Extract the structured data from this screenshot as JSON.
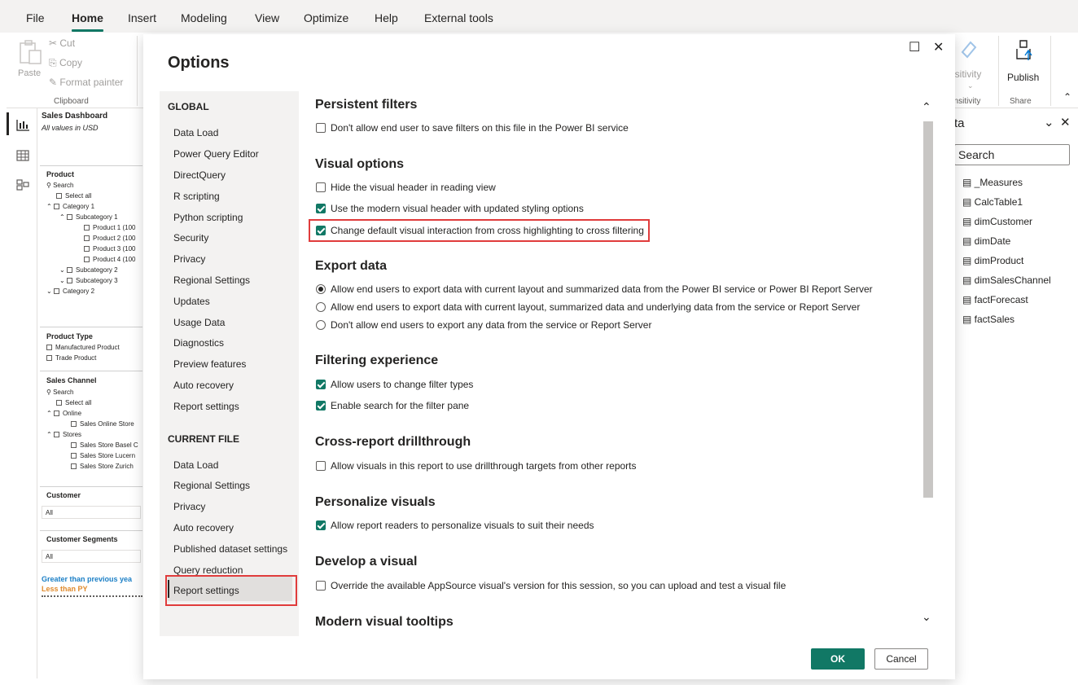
{
  "menu": {
    "tabs": [
      "File",
      "Home",
      "Insert",
      "Modeling",
      "View",
      "Optimize",
      "Help",
      "External tools"
    ]
  },
  "ribbon": {
    "paste": "Paste",
    "cut": "Cut",
    "copy": "Copy",
    "format_painter": "Format painter",
    "clipboard_group": "Clipboard",
    "sensitivity": "nsitivity",
    "sensitivity_group": "ensitivity",
    "publish": "Publish",
    "share_group": "Share"
  },
  "canvas": {
    "title": "Sales Dashboard",
    "subtitle": "All values in USD",
    "product_label": "Product",
    "search": "Search",
    "select_all": "Select all",
    "category1": "Category 1",
    "subcategory1": "Subcategory 1",
    "product1": "Product 1 (100",
    "product2": "Product 2 (100",
    "product3": "Product 3 (100",
    "product4": "Product 4 (100",
    "subcategory2": "Subcategory 2",
    "subcategory3": "Subcategory 3",
    "category2": "Category 2",
    "product_type": "Product Type",
    "manufactured": "Manufactured Product",
    "trade": "Trade Product",
    "sales_channel": "Sales Channel",
    "online": "Online",
    "online_store": "Sales Online Store",
    "stores": "Stores",
    "basel": "Sales Store Basel C",
    "lucern": "Sales Store Lucern",
    "zurich": "Sales Store Zurich",
    "customer": "Customer",
    "all": "All",
    "customer_segments": "Customer Segments",
    "greater": "Greater than previous yea",
    "less": "Less than PY"
  },
  "datapane": {
    "title": "ta",
    "search": "Search",
    "items": [
      "_Measures",
      "CalcTable1",
      "dimCustomer",
      "dimDate",
      "dimProduct",
      "dimSalesChannel",
      "factForecast",
      "factSales"
    ]
  },
  "dialog": {
    "title": "Options",
    "global_head": "GLOBAL",
    "global_items": [
      "Data Load",
      "Power Query Editor",
      "DirectQuery",
      "R scripting",
      "Python scripting",
      "Security",
      "Privacy",
      "Regional Settings",
      "Updates",
      "Usage Data",
      "Diagnostics",
      "Preview features",
      "Auto recovery",
      "Report settings"
    ],
    "current_head": "CURRENT FILE",
    "current_items": [
      "Data Load",
      "Regional Settings",
      "Privacy",
      "Auto recovery",
      "Published dataset settings",
      "Query reduction",
      "Report settings"
    ],
    "ok": "OK",
    "cancel": "Cancel",
    "sections": {
      "persistent": {
        "title": "Persistent filters",
        "opt1": "Don't allow end user to save filters on this file in the Power BI service"
      },
      "visual": {
        "title": "Visual options",
        "opt1": "Hide the visual header in reading view",
        "opt2": "Use the modern visual header with updated styling options",
        "opt3": "Change default visual interaction from cross highlighting to cross filtering"
      },
      "export": {
        "title": "Export data",
        "opt1": "Allow end users to export data with current layout and summarized data from the Power BI service or Power BI Report Server",
        "opt2": "Allow end users to export data with current layout, summarized data and underlying data from the service or Report Server",
        "opt3": "Don't allow end users to export any data from the service or Report Server"
      },
      "filtering": {
        "title": "Filtering experience",
        "opt1": "Allow users to change filter types",
        "opt2": "Enable search for the filter pane"
      },
      "drill": {
        "title": "Cross-report drillthrough",
        "opt1": "Allow visuals in this report to use drillthrough targets from other reports"
      },
      "personalize": {
        "title": "Personalize visuals",
        "opt1": "Allow report readers to personalize visuals to suit their needs"
      },
      "develop": {
        "title": "Develop a visual",
        "opt1": "Override the available AppSource visual's version for this session, so you can upload and test a visual file"
      },
      "tooltips": {
        "title": "Modern visual tooltips"
      }
    }
  },
  "colors": {
    "accent": "#117865",
    "highlight": "#e03c3c"
  }
}
